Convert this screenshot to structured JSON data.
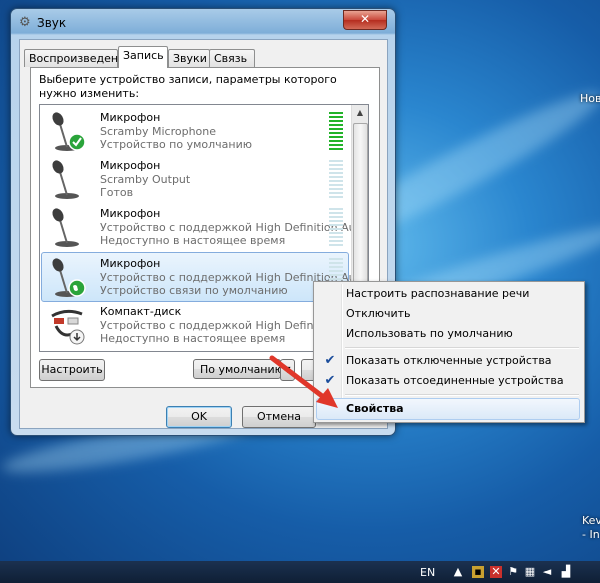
{
  "window": {
    "title": "Звук",
    "close_glyph": "✕",
    "tabs": [
      "Воспроизведение",
      "Запись",
      "Звуки",
      "Связь"
    ],
    "active_tab": "Запись",
    "instruction": "Выберите устройство записи, параметры которого нужно изменить:",
    "devices": [
      {
        "name": "Микрофон",
        "description": "Scramby Microphone",
        "status": "Устройство по умолчанию",
        "icon": "microphone-icon",
        "badge": "default-check-icon",
        "meter_level": 1.0
      },
      {
        "name": "Микрофон",
        "description": "Scramby Output",
        "status": "Готов",
        "icon": "microphone-icon",
        "badge": "",
        "meter_level": 0
      },
      {
        "name": "Микрофон",
        "description": "Устройство с поддержкой High Definition Au...",
        "status": "Недоступно в настоящее время",
        "icon": "microphone-icon",
        "badge": "",
        "meter_level": 0
      },
      {
        "name": "Микрофон",
        "description": "Устройство с поддержкой High Definition Au...",
        "status": "Устройство связи по умолчанию",
        "icon": "microphone-icon",
        "badge": "phone-icon",
        "meter_level": 0
      },
      {
        "name": "Компакт-диск",
        "description": "Устройство с поддержкой High Definition Au...",
        "status": "Недоступно в настоящее время",
        "icon": "cd-audio-cable-icon",
        "badge": "down-arrow-icon",
        "meter_level": 0
      }
    ],
    "buttons": {
      "configure": "Настроить",
      "set_default": "По умолчанию",
      "ok": "OK",
      "cancel": "Отмена"
    }
  },
  "context_menu": {
    "items": [
      {
        "label": "Настроить распознавание речи",
        "checked": false
      },
      {
        "label": "Отключить",
        "checked": false
      },
      {
        "label": "Использовать по умолчанию",
        "checked": false
      },
      {
        "label": "Показать отключенные устройства",
        "checked": true
      },
      {
        "label": "Показать отсоединенные устройства",
        "checked": true
      },
      {
        "label": "Свойства",
        "checked": false,
        "highlighted": true,
        "bold": true
      }
    ]
  },
  "desktop": {
    "text_right_1": "Нов",
    "text_right_2": "Kev",
    "text_right_3": "- In"
  },
  "taskbar": {
    "language": "EN"
  },
  "colors": {
    "meter_active": "#22b32a",
    "meter_idle": "#cfe4ea",
    "check": "#1b4d9b",
    "arrow": "#e0372a"
  }
}
